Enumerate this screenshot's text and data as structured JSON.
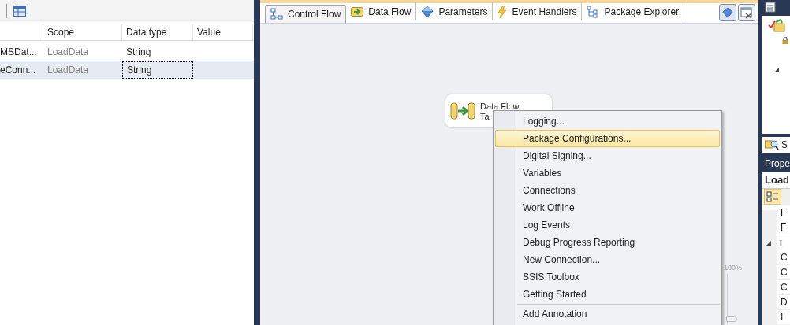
{
  "variables_table": {
    "columns": [
      {
        "label": "Scope"
      },
      {
        "label": "Data type"
      },
      {
        "label": "Value"
      }
    ],
    "rows": [
      {
        "name": "MSDat...",
        "scope": "LoadData",
        "data_type": "String",
        "selected": false,
        "focused": false
      },
      {
        "name": "eConn...",
        "scope": "LoadData",
        "data_type": "String",
        "selected": true,
        "focused": true
      }
    ]
  },
  "designer_tabs": [
    {
      "label": "Control Flow",
      "selected": true
    },
    {
      "label": "Data Flow",
      "selected": false
    },
    {
      "label": "Parameters",
      "selected": false
    },
    {
      "label": "Event Handlers",
      "selected": false
    },
    {
      "label": "Package Explorer",
      "selected": false
    }
  ],
  "canvas": {
    "task": {
      "line_1": "Data Flow",
      "line_2": "Ta"
    },
    "zoom_label": "100%",
    "zoom_slider": {
      "level": 0.05
    }
  },
  "context_menu": [
    {
      "kind": "item",
      "label": "Logging...",
      "selected": false
    },
    {
      "kind": "item",
      "label": "Package Configurations...",
      "selected": true
    },
    {
      "kind": "item",
      "label": "Digital Signing...",
      "selected": false
    },
    {
      "kind": "item",
      "label": "Variables",
      "selected": false
    },
    {
      "kind": "item",
      "label": "Connections",
      "selected": false
    },
    {
      "kind": "item",
      "label": "Work Offline",
      "selected": false
    },
    {
      "kind": "item",
      "label": "Log Events",
      "selected": false
    },
    {
      "kind": "item",
      "label": "Debug Progress Reporting",
      "selected": false
    },
    {
      "kind": "item",
      "label": "New Connection...",
      "selected": false
    },
    {
      "kind": "item",
      "label": "SSIS Toolbox",
      "selected": false
    },
    {
      "kind": "item",
      "label": "Getting Started",
      "selected": false
    },
    {
      "kind": "separator"
    },
    {
      "kind": "item",
      "label": "Add Annotation",
      "selected": false
    }
  ],
  "solution_explorer": {
    "tab_label": "S"
  },
  "properties": {
    "title": "Prope",
    "object": "Load",
    "rows": [
      {
        "kind": "row",
        "label": "F"
      },
      {
        "kind": "row",
        "label": "F"
      },
      {
        "kind": "category",
        "label": "I"
      },
      {
        "kind": "row",
        "label": "C"
      },
      {
        "kind": "row",
        "label": "C"
      },
      {
        "kind": "row",
        "label": "C"
      },
      {
        "kind": "row",
        "label": "D"
      },
      {
        "kind": "row",
        "label": "I"
      }
    ]
  }
}
